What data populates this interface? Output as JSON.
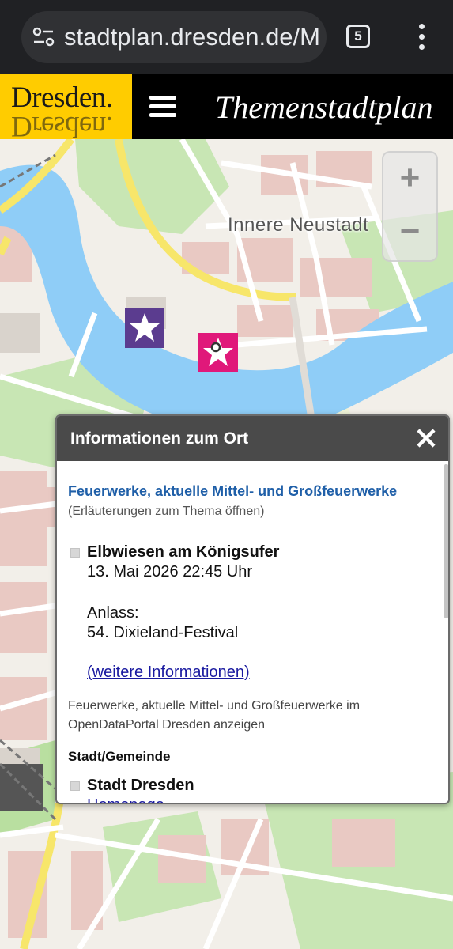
{
  "browser": {
    "url": "stadtplan.dresden.de/M",
    "tab_count": "5",
    "site_icon": "site-settings-icon",
    "menu_icon": "more-vert-icon"
  },
  "header": {
    "logo_text": "Dresden.",
    "menu_icon": "hamburger-menu-icon",
    "title": "Themenstadtplan",
    "logo_color": "#ffcc00"
  },
  "map": {
    "district_label": "Innere Neustadt",
    "zoom_in": "+",
    "zoom_out": "−",
    "river_color": "#8fcdf7",
    "markers": [
      "star-marker-icon",
      "firework-star-marker-icon"
    ]
  },
  "popup": {
    "title": "Informationen zum Ort",
    "close_icon": "close-icon",
    "theme_link": "Feuerwerke, aktuelle Mittel- und Großfeuerwerke",
    "theme_hint": "(Erläuterungen zum Thema öffnen)",
    "place_name": "Elbwiesen am Königsufer",
    "place_date": "13. Mai 2026 22:45 Uhr",
    "anlass_label": "Anlass:",
    "anlass_value": "54. Dixieland-Festival",
    "more_link": "(weitere Informationen)",
    "portal_text": "Feuerwerke, aktuelle Mittel- und Großfeuerwerke im OpenDataPortal Dresden anzeigen",
    "section_head": "Stadt/Gemeinde",
    "city_name": "Stadt Dresden",
    "homepage_link": "Homepage",
    "link_color": "#1f5fa8"
  }
}
